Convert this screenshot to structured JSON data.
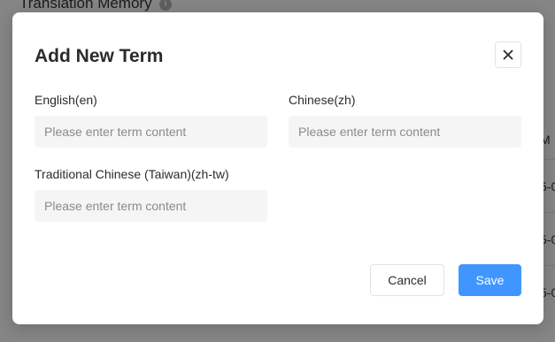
{
  "background": {
    "page_title": "Translation Memory",
    "table_header_fragment": "M",
    "row_fragments": [
      "5-0",
      "5-0",
      "5-0"
    ]
  },
  "dialog": {
    "title": "Add New Term",
    "fields": [
      {
        "label": "English(en)",
        "placeholder": "Please enter term content",
        "value": ""
      },
      {
        "label": "Chinese(zh)",
        "placeholder": "Please enter term content",
        "value": ""
      },
      {
        "label": "Traditional Chinese (Taiwan)(zh-tw)",
        "placeholder": "Please enter term content",
        "value": ""
      }
    ],
    "cancel_label": "Cancel",
    "save_label": "Save"
  },
  "colors": {
    "primary": "#4096ff",
    "overlay": "rgba(0,0,0,0.48)",
    "input_bg": "#f5f5f5"
  }
}
